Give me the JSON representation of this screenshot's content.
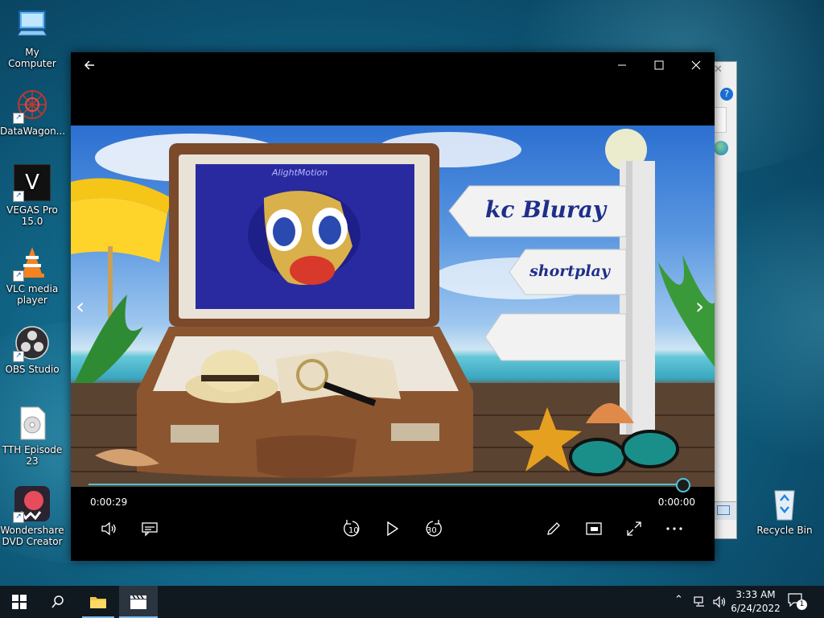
{
  "desktop": {
    "icons": [
      {
        "label": "My Computer",
        "icon": "computer-icon"
      },
      {
        "label": "DataWagon...",
        "icon": "datawagon-icon"
      },
      {
        "label": "VEGAS Pro 15.0",
        "icon": "vegas-icon"
      },
      {
        "label": "VLC media player",
        "icon": "vlc-icon"
      },
      {
        "label": "OBS Studio",
        "icon": "obs-icon"
      },
      {
        "label": "TTH Episode 23",
        "icon": "disc-file-icon"
      },
      {
        "label": "Wondershare DVD Creator",
        "icon": "wondershare-icon"
      },
      {
        "label": "Recycle Bin",
        "icon": "recycle-bin-icon"
      }
    ],
    "vegas_glyph": "V"
  },
  "player": {
    "video": {
      "watermark": "AlightMotion",
      "sign_title": "kc Bluray",
      "sign_subtitle": "shortplay",
      "sign_blank": ""
    },
    "current_time": "0:00:29",
    "total_time": "0:00:00",
    "progress": 0.99,
    "rewind_label": "10",
    "forward_label": "30"
  },
  "taskbar": {
    "time": "3:33 AM",
    "date": "6/24/2022",
    "notification_count": "1"
  },
  "colors": {
    "accent": "#4fc3d9",
    "taskbar": "#101820",
    "player_bg": "#000000"
  }
}
